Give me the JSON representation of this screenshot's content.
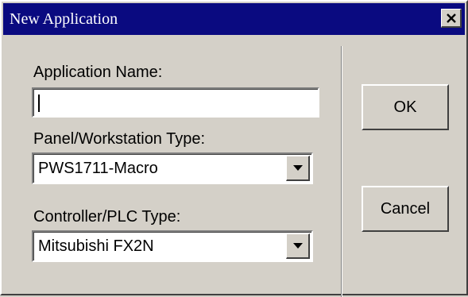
{
  "window": {
    "title": "New Application",
    "close_icon": "close-x-icon"
  },
  "form": {
    "app_name_label": "Application Name:",
    "app_name_value": "",
    "panel_label": "Panel/Workstation Type:",
    "panel_value": "PWS1711-Macro",
    "controller_label": "Controller/PLC Type:",
    "controller_value": "Mitsubishi FX2N",
    "dropdown_icon": "triangle-down-icon"
  },
  "buttons": {
    "ok_label": "OK",
    "cancel_label": "Cancel"
  },
  "colors": {
    "titlebar": "#0a0a80",
    "face": "#d4d0c8"
  }
}
